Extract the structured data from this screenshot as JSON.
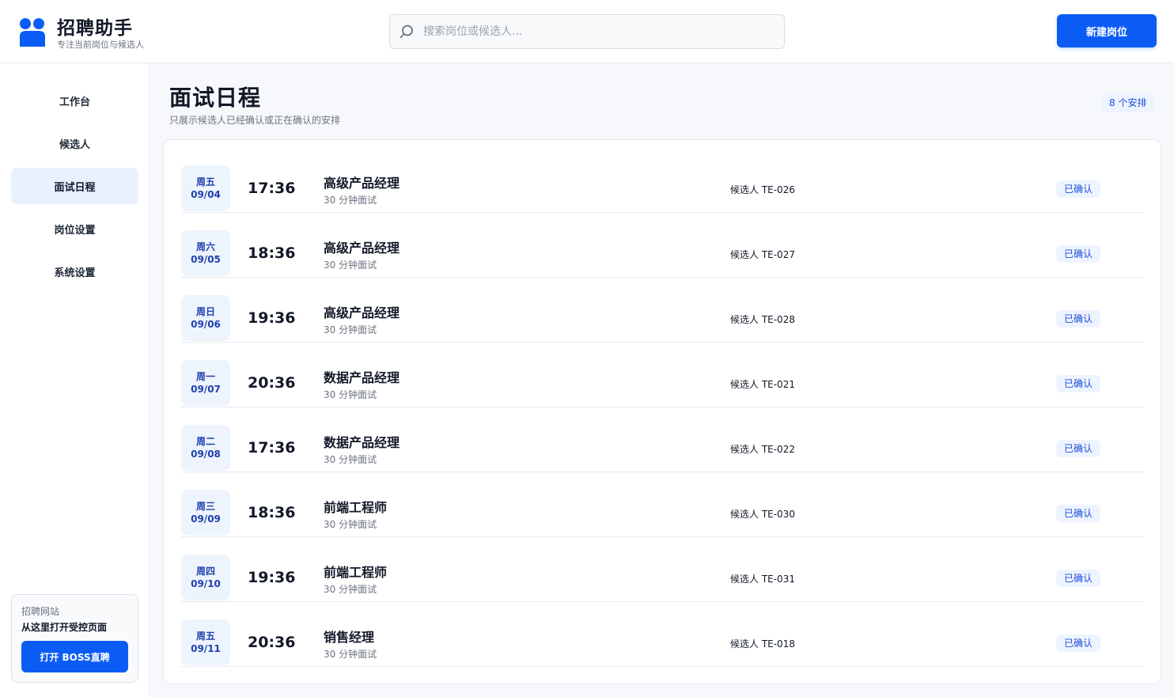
{
  "brand": {
    "title": "招聘助手",
    "subtitle": "专注当前岗位与候选人"
  },
  "header": {
    "search_placeholder": "搜索岗位或候选人...",
    "new_button": "新建岗位"
  },
  "sidebar": {
    "items": [
      {
        "label": "工作台",
        "active": false
      },
      {
        "label": "候选人",
        "active": false
      },
      {
        "label": "面试日程",
        "active": true
      },
      {
        "label": "岗位设置",
        "active": false
      },
      {
        "label": "系统设置",
        "active": false
      }
    ],
    "promo": {
      "label": "招聘网站",
      "title": "从这里打开受控页面",
      "button": "打开 BOSS直聘"
    }
  },
  "page": {
    "title": "面试日程",
    "subtitle": "只展示候选人已经确认或正在确认的安排",
    "count": "8 个安排"
  },
  "schedule": [
    {
      "weekday": "周五",
      "date": "09/04",
      "time": "17:36",
      "job": "高级产品经理",
      "duration": "30 分钟面试",
      "candidate": "候选人 TE-026",
      "status": "已确认"
    },
    {
      "weekday": "周六",
      "date": "09/05",
      "time": "18:36",
      "job": "高级产品经理",
      "duration": "30 分钟面试",
      "candidate": "候选人 TE-027",
      "status": "已确认"
    },
    {
      "weekday": "周日",
      "date": "09/06",
      "time": "19:36",
      "job": "高级产品经理",
      "duration": "30 分钟面试",
      "candidate": "候选人 TE-028",
      "status": "已确认"
    },
    {
      "weekday": "周一",
      "date": "09/07",
      "time": "20:36",
      "job": "数据产品经理",
      "duration": "30 分钟面试",
      "candidate": "候选人 TE-021",
      "status": "已确认"
    },
    {
      "weekday": "周二",
      "date": "09/08",
      "time": "17:36",
      "job": "数据产品经理",
      "duration": "30 分钟面试",
      "candidate": "候选人 TE-022",
      "status": "已确认"
    },
    {
      "weekday": "周三",
      "date": "09/09",
      "time": "18:36",
      "job": "前端工程师",
      "duration": "30 分钟面试",
      "candidate": "候选人 TE-030",
      "status": "已确认"
    },
    {
      "weekday": "周四",
      "date": "09/10",
      "time": "19:36",
      "job": "前端工程师",
      "duration": "30 分钟面试",
      "candidate": "候选人 TE-031",
      "status": "已确认"
    },
    {
      "weekday": "周五",
      "date": "09/11",
      "time": "20:36",
      "job": "销售经理",
      "duration": "30 分钟面试",
      "candidate": "候选人 TE-018",
      "status": "已确认"
    }
  ],
  "colors": {
    "accent": "#0b5cf5",
    "badge_bg": "#eef4ff",
    "badge_text": "#1d4ed8"
  }
}
